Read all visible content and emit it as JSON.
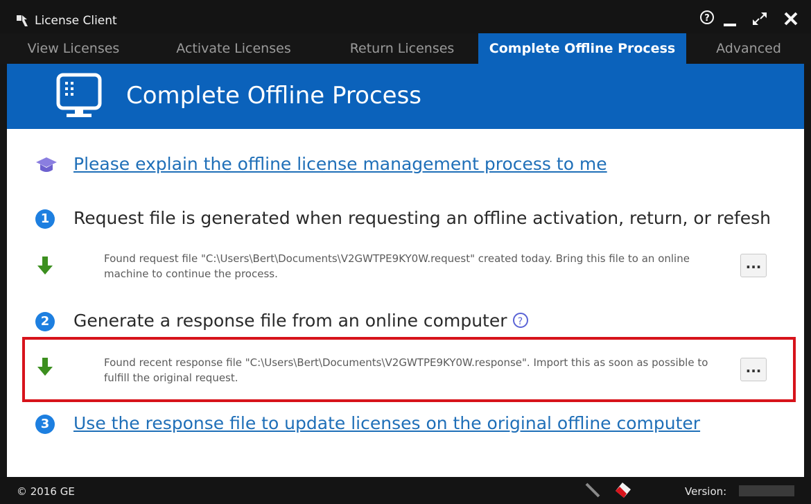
{
  "window": {
    "title": "License Client"
  },
  "tabs": [
    {
      "label": "View Licenses",
      "active": false
    },
    {
      "label": "Activate Licenses",
      "active": false
    },
    {
      "label": "Return Licenses",
      "active": false
    },
    {
      "label": "Complete Offline Process",
      "active": true
    },
    {
      "label": "Advanced",
      "active": false
    }
  ],
  "header": {
    "title": "Complete Offline Process",
    "icon": "monitor-icon"
  },
  "explain": {
    "link": "Please explain the offline license management process to me",
    "icon": "graduation-cap-icon"
  },
  "steps": [
    {
      "number": "1",
      "text": "Request file is generated when requesting an offline activation, return, or refesh",
      "message": "Found request file \"C:\\Users\\Bert\\Documents\\V2GWTPE9KY0W.request\" created today. Bring this file to an online machine to continue the process.",
      "button": "..."
    },
    {
      "number": "2",
      "text": "Generate a response file from an online computer",
      "help": "?",
      "message": "Found recent response file \"C:\\Users\\Bert\\Documents\\V2GWTPE9KY0W.response\". Import this as soon as possible to fulfill the original request.",
      "button": "..."
    },
    {
      "number": "3",
      "text": "Use the response file to update licenses on the original offline computer"
    }
  ],
  "statusbar": {
    "copyright": "© 2016 GE",
    "version_label": "Version:"
  },
  "colors": {
    "accent": "#0b62bb",
    "step_circle": "#1d7fe0",
    "arrow": "#3c8f1f",
    "highlight": "#d7131b",
    "link": "#1f6fb8"
  }
}
